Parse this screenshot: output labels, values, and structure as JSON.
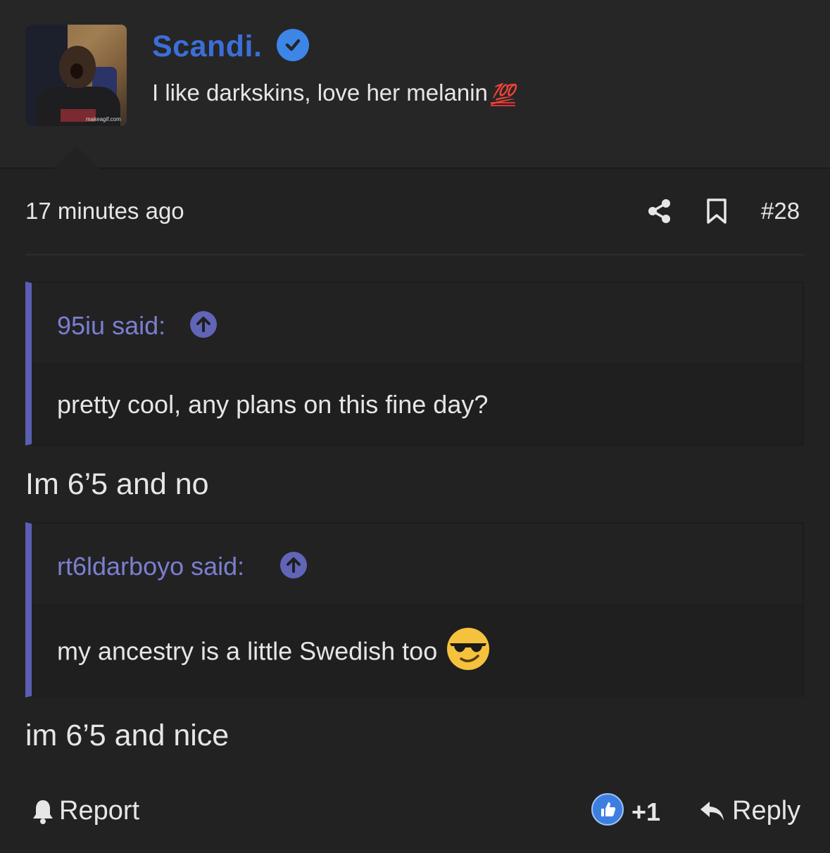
{
  "post": {
    "username": "Scandi.",
    "signature": "I like darkskins, love her melanin",
    "signature_emoji": "💯",
    "avatar_watermark": "makeagif.com",
    "timestamp": "17 minutes ago",
    "post_number": "#28"
  },
  "quotes": [
    {
      "author": "95iu said:",
      "text": "pretty cool, any plans on this fine day?"
    },
    {
      "author": "rt6ldarboyo said:",
      "text": "my ancestry is a little Swedish too",
      "emoji": "sunglasses-emoji"
    }
  ],
  "replies": [
    "Im 6’5 and no",
    "im 6’5 and nice"
  ],
  "actions": {
    "report_label": "Report",
    "like_count": "+1",
    "reply_label": "Reply"
  },
  "colors": {
    "username": "#3b6fd8",
    "quote_accent": "#5b5fb3",
    "quote_author": "#7b7fd0",
    "background": "#222223"
  }
}
